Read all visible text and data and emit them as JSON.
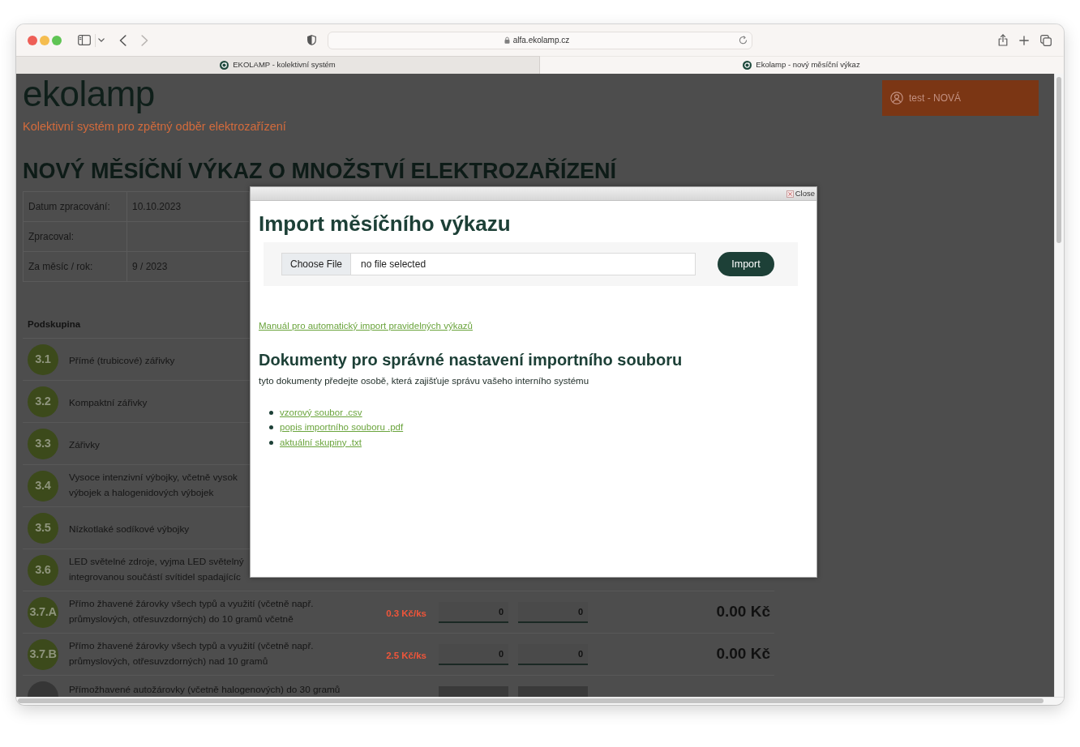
{
  "browser": {
    "back_disabled": false,
    "forward_disabled": true,
    "address": "alfa.ekolamp.cz",
    "tabs": [
      {
        "title": "EKOLAMP - kolektivní systém",
        "selected": false
      },
      {
        "title": "Ekolamp - nový měsíční výkaz",
        "selected": true
      }
    ]
  },
  "page": {
    "logo": "ekolamp",
    "tagline": "Kolektivní systém pro zpětný odběr elektrozařízení",
    "user_button": "test - NOVÁ",
    "heading": "NOVÝ MĚSÍČNÍ VÝKAZ O MNOŽSTVÍ ELEKTROZAŘÍZENÍ",
    "info": [
      {
        "label": "Datum zpracování:",
        "value": "10.10.2023"
      },
      {
        "label": "Zpracoval:"
      },
      {
        "label": "Za měsíc / rok:",
        "value": "9 / 2023"
      }
    ],
    "table": {
      "columns": [
        "Podskupina"
      ],
      "rows": [
        {
          "kind": "covered",
          "disabled": false,
          "code": "3.1",
          "lines": [
            "Přímé (trubicové) zářivky"
          ]
        },
        {
          "kind": "covered",
          "disabled": false,
          "code": "3.2",
          "lines": [
            "Kompaktní zářivky"
          ]
        },
        {
          "kind": "covered",
          "disabled": false,
          "code": "3.3",
          "lines": [
            "Zářivky"
          ]
        },
        {
          "kind": "covered",
          "disabled": false,
          "code": "3.4",
          "lines": [
            "Vysoce intenzivní výbojky, včetně vysok",
            "výbojek a halogenidových výbojek"
          ]
        },
        {
          "kind": "covered",
          "disabled": false,
          "code": "3.5",
          "lines": [
            "Nízkotlaké sodíkové výbojky"
          ]
        },
        {
          "kind": "covered",
          "disabled": false,
          "code": "3.6",
          "lines": [
            "LED světelné zdroje, vyjma LED světelný",
            "integrovanou součástí svítidel spadajícíc"
          ]
        },
        {
          "kind": "full",
          "disabled": false,
          "code": "3.7.A",
          "lines": [
            "Přímo žhavené žárovky všech typů a využití (včetně např.",
            "průmyslových, otřesuvzdorných) do 10 gramů včetně"
          ],
          "price": "0.3 Kč/ks",
          "quantities": [
            "0",
            "0"
          ],
          "total": "0.00 Kč"
        },
        {
          "kind": "full",
          "disabled": false,
          "code": "3.7.B",
          "lines": [
            "Přímo žhavené žárovky všech typů a využití (včetně např.",
            "průmyslových, otřesuvzdorných) nad 10 gramů"
          ],
          "price": "2.5 Kč/ks",
          "quantities": [
            "0",
            "0"
          ],
          "total": "0.00 Kč"
        },
        {
          "kind": "cut",
          "disabled": true,
          "lines": [
            "Přímožhavené autožárovky (včetně halogenových) do 30 gramů"
          ]
        }
      ]
    }
  },
  "dialog": {
    "close": "Close",
    "title": "Import měsíčního výkazu",
    "file_button": "Choose File",
    "file_status": "no file selected",
    "import_button": "Import",
    "manual_link": "Manuál pro automatický import pravidelných výkazů",
    "documents_heading": "Dokumenty pro správné nastavení importního souboru",
    "documents_note": "tyto dokumenty předejte osobě, která zajišťuje správu vašeho interního systému",
    "documents": [
      "vzorový soubor .csv",
      "popis importního souboru .pdf",
      "aktuální skupiny .txt"
    ]
  }
}
